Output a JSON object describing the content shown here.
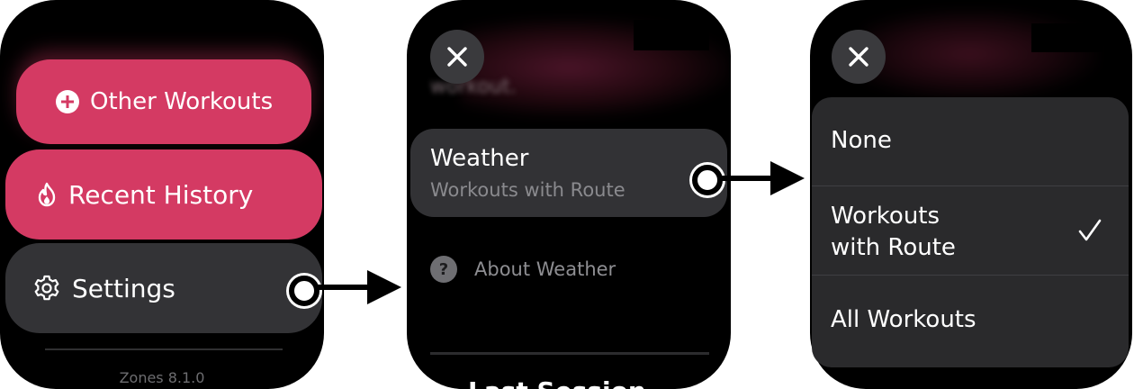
{
  "screen1": {
    "other_workouts": "Other Workouts",
    "recent_history": "Recent History",
    "settings": "Settings",
    "version": "Zones 8.1.0"
  },
  "screen2": {
    "blurred_text": "workout.",
    "weather_title": "Weather",
    "weather_value": "Workouts with Route",
    "about_weather": "About Weather",
    "about_icon_glyph": "?",
    "cut_text": "Last Session"
  },
  "screen3": {
    "options": [
      {
        "label": "None",
        "selected": false
      },
      {
        "label_line1": "Workouts",
        "label_line2": "with Route",
        "selected": true
      },
      {
        "label": "All Workouts",
        "selected": false
      }
    ]
  },
  "icons": {
    "plus": "plus-circle-icon",
    "flame": "flame-icon",
    "gear": "gear-icon",
    "close": "close-icon",
    "question": "question-circle-icon",
    "check": "checkmark-icon"
  },
  "colors": {
    "accent_pink": "#d43a63",
    "button_gray": "#333336",
    "sheet_gray": "#2a2a2c"
  }
}
